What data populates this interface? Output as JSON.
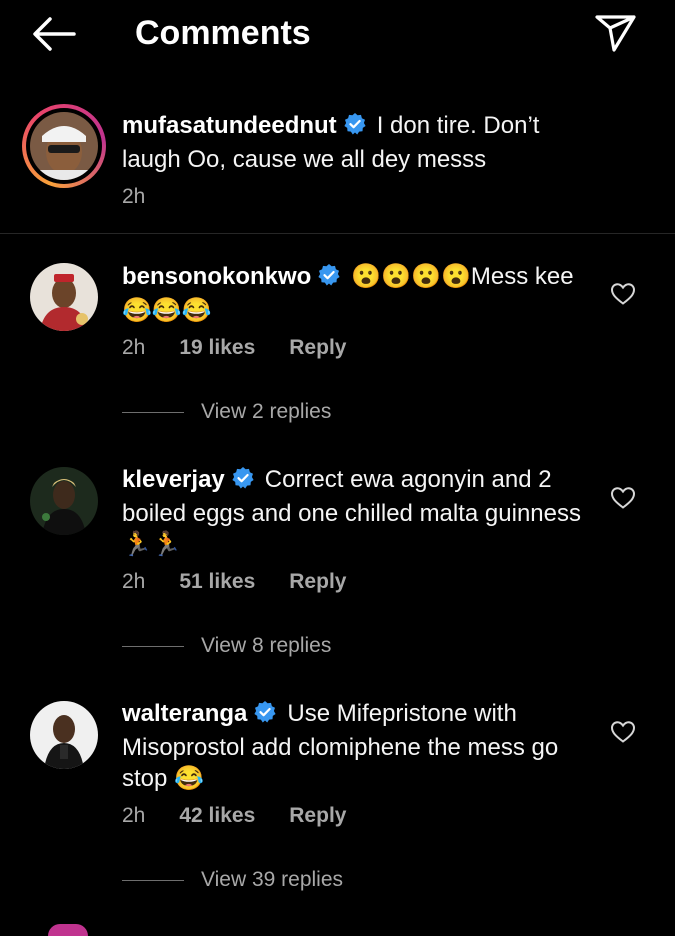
{
  "header": {
    "title": "Comments",
    "back_icon": "arrow-left-icon",
    "share_icon": "paper-plane-icon"
  },
  "caption": {
    "username": "mufasatundeednut",
    "verified": true,
    "text": "I don tire. Don’t laugh Oo, cause we all dey messs",
    "time": "2h"
  },
  "comments": [
    {
      "username": "bensonokonkwo",
      "verified": true,
      "emoji_prefix": "😮😮😮😮",
      "text": "Mess kee",
      "emoji_suffix": "😂😂😂",
      "time": "2h",
      "likes": "19 likes",
      "reply_label": "Reply",
      "view_replies": "View 2 replies"
    },
    {
      "username": "kleverjay",
      "verified": true,
      "text": "Correct ewa agonyin and 2 boiled eggs and one chilled malta guinness",
      "emoji_suffix": "🏃🏃",
      "time": "2h",
      "likes": "51 likes",
      "reply_label": "Reply",
      "view_replies": "View 8 replies"
    },
    {
      "username": "walteranga",
      "verified": true,
      "text": "Use Mifepristone with Misoprostol add clomiphene the mess go stop",
      "emoji_suffix": "😂",
      "time": "2h",
      "likes": "42 likes",
      "reply_label": "Reply",
      "view_replies": "View 39 replies"
    }
  ],
  "colors": {
    "background": "#000000",
    "text": "#f5f5f5",
    "secondary_text": "#a8a8a8",
    "verified_badge": "#3897f0",
    "divider": "#262626"
  }
}
